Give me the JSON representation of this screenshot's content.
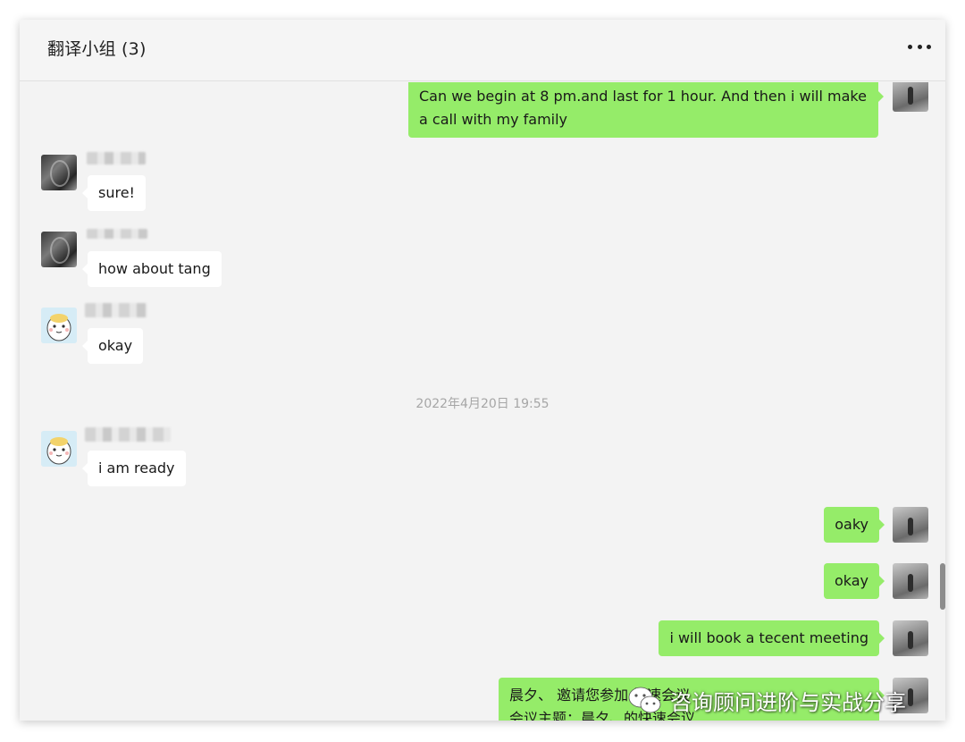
{
  "header": {
    "title": "翻译小组 (3)",
    "more_icon": "more-horizontal-icon"
  },
  "messages": [
    {
      "sender": "self",
      "text": "Can we begin at 8 pm.and last for 1 hour. And then i will make a call with my family"
    },
    {
      "sender": "member1",
      "text": "sure!"
    },
    {
      "sender": "member1",
      "text": "how about tang"
    },
    {
      "sender": "member2",
      "text": "okay"
    },
    {
      "sender": "member2",
      "text": "i am ready"
    },
    {
      "sender": "self",
      "text": "oaky"
    },
    {
      "sender": "self",
      "text": "okay"
    },
    {
      "sender": "self",
      "text": "i will book a tecent meeting"
    },
    {
      "sender": "self",
      "text": "晨夕、 邀请您参加 快速会议\n会议主题：晨夕、的快速会议"
    }
  ],
  "timestamp": "2022年4月20日 19:55",
  "watermark": {
    "text": "咨询顾问进阶与实战分享",
    "icon": "wechat-icon"
  },
  "colors": {
    "outgoing_bubble": "#95ec69",
    "incoming_bubble": "#ffffff",
    "chat_background": "#f3f3f3"
  }
}
